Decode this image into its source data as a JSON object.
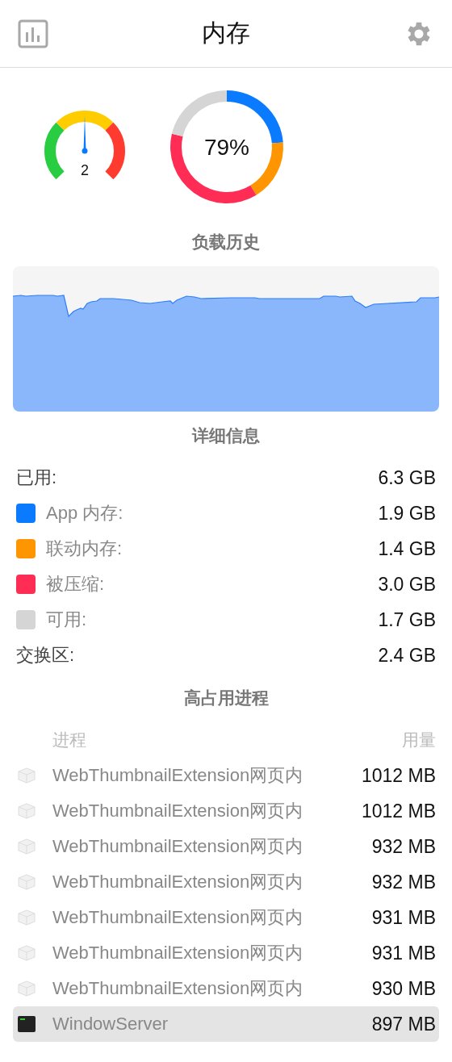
{
  "window": {
    "title": "内存"
  },
  "pressure": {
    "reading": "2"
  },
  "usage": {
    "reading": "79%",
    "chart_data": {
      "type": "donut",
      "values": [
        23.75,
        17.5,
        37.5,
        21.25
      ]
    }
  },
  "history": {
    "title": "负载历史"
  },
  "details": {
    "title": "详细信息",
    "rows": [
      {
        "kind": "total",
        "label": "已用:",
        "value": "6.3 GB"
      },
      {
        "kind": "part",
        "label": "App 内存:",
        "value": "1.9 GB",
        "color": "#0a7aff"
      },
      {
        "kind": "part",
        "label": "联动内存:",
        "value": "1.4 GB",
        "color": "#ff9500"
      },
      {
        "kind": "part",
        "label": "被压缩:",
        "value": "3.0 GB",
        "color": "#ff2d55"
      },
      {
        "kind": "part",
        "label": "可用:",
        "value": "1.7 GB",
        "color": "#d5d5d5"
      },
      {
        "kind": "total",
        "label": "交换区:",
        "value": "2.4 GB"
      }
    ]
  },
  "processes": {
    "title": "高占用进程",
    "columns": [
      "进程",
      "用量"
    ],
    "rows": [
      {
        "kind": "extension",
        "name": "WebThumbnailExtension网页内",
        "usage": "1012 MB",
        "selected": false
      },
      {
        "kind": "extension",
        "name": "WebThumbnailExtension网页内",
        "usage": "1012 MB",
        "selected": false
      },
      {
        "kind": "extension",
        "name": "WebThumbnailExtension网页内",
        "usage": "932 MB",
        "selected": false
      },
      {
        "kind": "extension",
        "name": "WebThumbnailExtension网页内",
        "usage": "932 MB",
        "selected": false
      },
      {
        "kind": "extension",
        "name": "WebThumbnailExtension网页内",
        "usage": "931 MB",
        "selected": false
      },
      {
        "kind": "extension",
        "name": "WebThumbnailExtension网页内",
        "usage": "931 MB",
        "selected": false
      },
      {
        "kind": "extension",
        "name": "WebThumbnailExtension网页内",
        "usage": "930 MB",
        "selected": false
      },
      {
        "kind": "terminal",
        "name": "WindowServer",
        "usage": "897 MB",
        "selected": true
      }
    ]
  }
}
